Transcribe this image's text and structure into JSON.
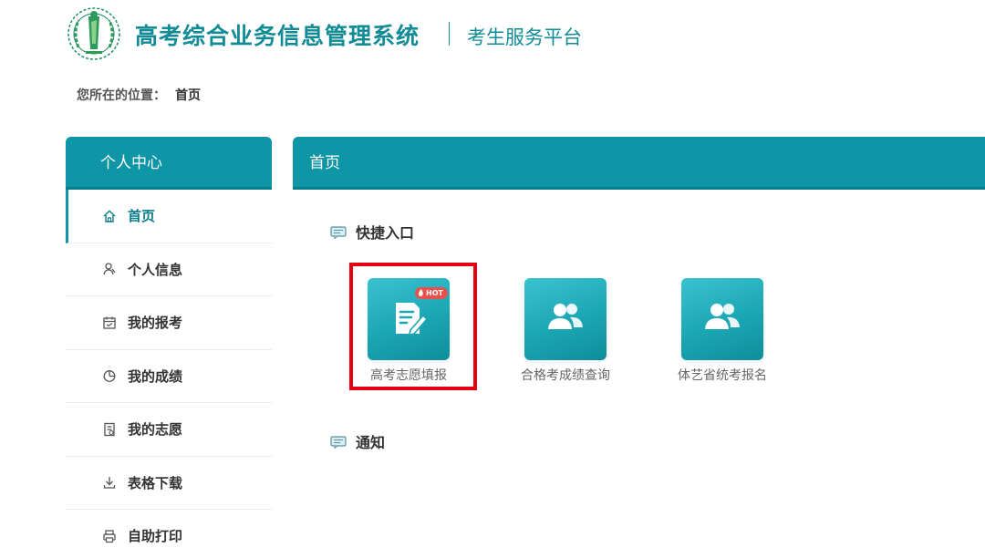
{
  "header": {
    "system_title": "高考综合业务信息管理系统",
    "subtitle": "考生服务平台",
    "logo_icon": "emblem-icon"
  },
  "breadcrumb": {
    "prefix": "您所在的位置：",
    "current": "首页"
  },
  "sidebar": {
    "title": "个人中心",
    "items": [
      {
        "label": "首页",
        "icon": "home-icon",
        "active": true
      },
      {
        "label": "个人信息",
        "icon": "user-icon",
        "active": false
      },
      {
        "label": "我的报考",
        "icon": "calendar-icon",
        "active": false
      },
      {
        "label": "我的成绩",
        "icon": "pie-chart-icon",
        "active": false
      },
      {
        "label": "我的志愿",
        "icon": "document-icon",
        "active": false
      },
      {
        "label": "表格下载",
        "icon": "download-icon",
        "active": false
      },
      {
        "label": "自助打印",
        "icon": "printer-icon",
        "active": false
      }
    ]
  },
  "main": {
    "title": "首页",
    "quick_section_title": "快捷入口",
    "quick_links": [
      {
        "label": "高考志愿填报",
        "icon": "form-edit-icon",
        "badge": "HOT",
        "highlighted": true
      },
      {
        "label": "合格考成绩查询",
        "icon": "users-icon",
        "badge": "",
        "highlighted": false
      },
      {
        "label": "体艺省统考报名",
        "icon": "users-icon",
        "badge": "",
        "highlighted": false
      }
    ],
    "notice_section_title": "通知"
  },
  "colors": {
    "primary": "#0f96a6",
    "primary_dark": "#0a7d8b",
    "title_text": "#118c96",
    "highlight": "#e60012",
    "hot_badge": "#e8514b"
  }
}
